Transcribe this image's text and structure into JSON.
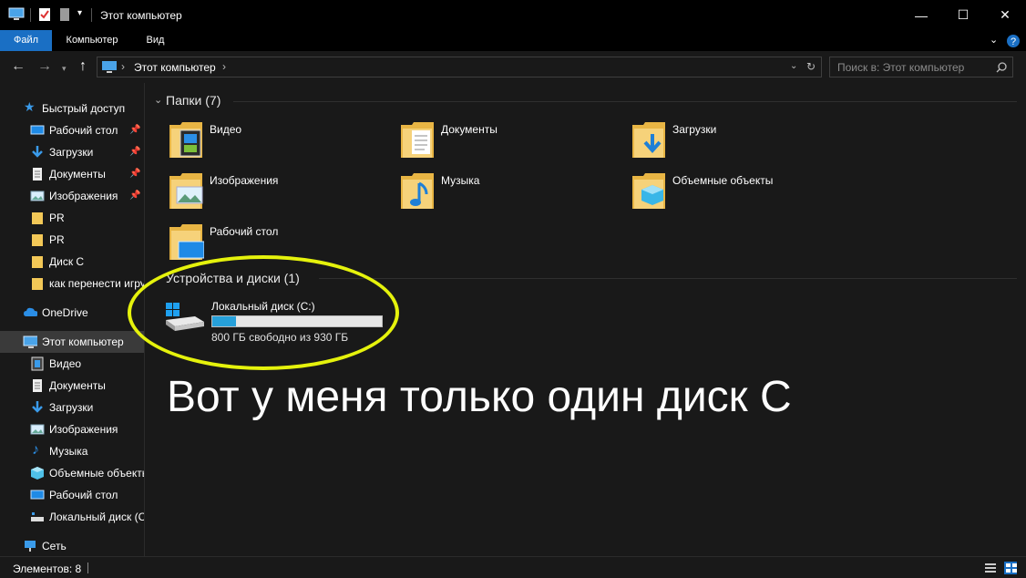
{
  "window": {
    "title": "Этот компьютер",
    "minimize_glyph": "—",
    "maximize_glyph": "☐",
    "close_glyph": "✕"
  },
  "ribbon": {
    "tabs": [
      "Файл",
      "Компьютер",
      "Вид"
    ],
    "active_tab": "Файл",
    "accent": "#1a6fc4"
  },
  "address": {
    "path": "Этот компьютер",
    "separator": "›",
    "search_placeholder": "Поиск в: Этот компьютер"
  },
  "sidebar": {
    "quick_access": {
      "label": "Быстрый доступ",
      "items": [
        {
          "label": "Рабочий стол",
          "icon": "desktop-icon",
          "pinned": true
        },
        {
          "label": "Загрузки",
          "icon": "download-icon",
          "pinned": true
        },
        {
          "label": "Документы",
          "icon": "document-icon",
          "pinned": true
        },
        {
          "label": "Изображения",
          "icon": "image-icon",
          "pinned": true
        },
        {
          "label": "PR",
          "icon": "folder-icon",
          "pinned": false
        },
        {
          "label": "PR",
          "icon": "folder-icon",
          "pinned": false
        },
        {
          "label": "Диск С",
          "icon": "folder-icon",
          "pinned": false
        },
        {
          "label": "как перенести игру",
          "icon": "folder-icon",
          "pinned": false
        }
      ]
    },
    "onedrive": {
      "label": "OneDrive"
    },
    "this_pc": {
      "label": "Этот компьютер",
      "items": [
        {
          "label": "Видео",
          "icon": "video-icon"
        },
        {
          "label": "Документы",
          "icon": "document-icon"
        },
        {
          "label": "Загрузки",
          "icon": "download-icon"
        },
        {
          "label": "Изображения",
          "icon": "image-icon"
        },
        {
          "label": "Музыка",
          "icon": "music-icon"
        },
        {
          "label": "Объемные объекты",
          "icon": "3d-objects-icon"
        },
        {
          "label": "Рабочий стол",
          "icon": "desktop-icon"
        },
        {
          "label": "Локальный диск (C:)",
          "icon": "drive-icon"
        }
      ]
    },
    "network": {
      "label": "Сеть"
    }
  },
  "folders": {
    "header": "Папки (7)",
    "items": [
      {
        "label": "Видео",
        "icon": "video-icon"
      },
      {
        "label": "Документы",
        "icon": "document-icon"
      },
      {
        "label": "Загрузки",
        "icon": "download-icon"
      },
      {
        "label": "Изображения",
        "icon": "image-icon"
      },
      {
        "label": "Музыка",
        "icon": "music-icon"
      },
      {
        "label": "Объемные объекты",
        "icon": "3d-objects-icon"
      },
      {
        "label": "Рабочий стол",
        "icon": "desktop-icon"
      }
    ]
  },
  "devices": {
    "header": "Устройства и диски (1)",
    "drive": {
      "name": "Локальный диск (C:)",
      "free_text": "800 ГБ свободно из 930 ГБ",
      "used_fraction": 0.14
    }
  },
  "annotation": {
    "text": "Вот у меня только один диск С",
    "ring_color": "#e5f20c"
  },
  "status": {
    "items_count": "Элементов: 8"
  }
}
